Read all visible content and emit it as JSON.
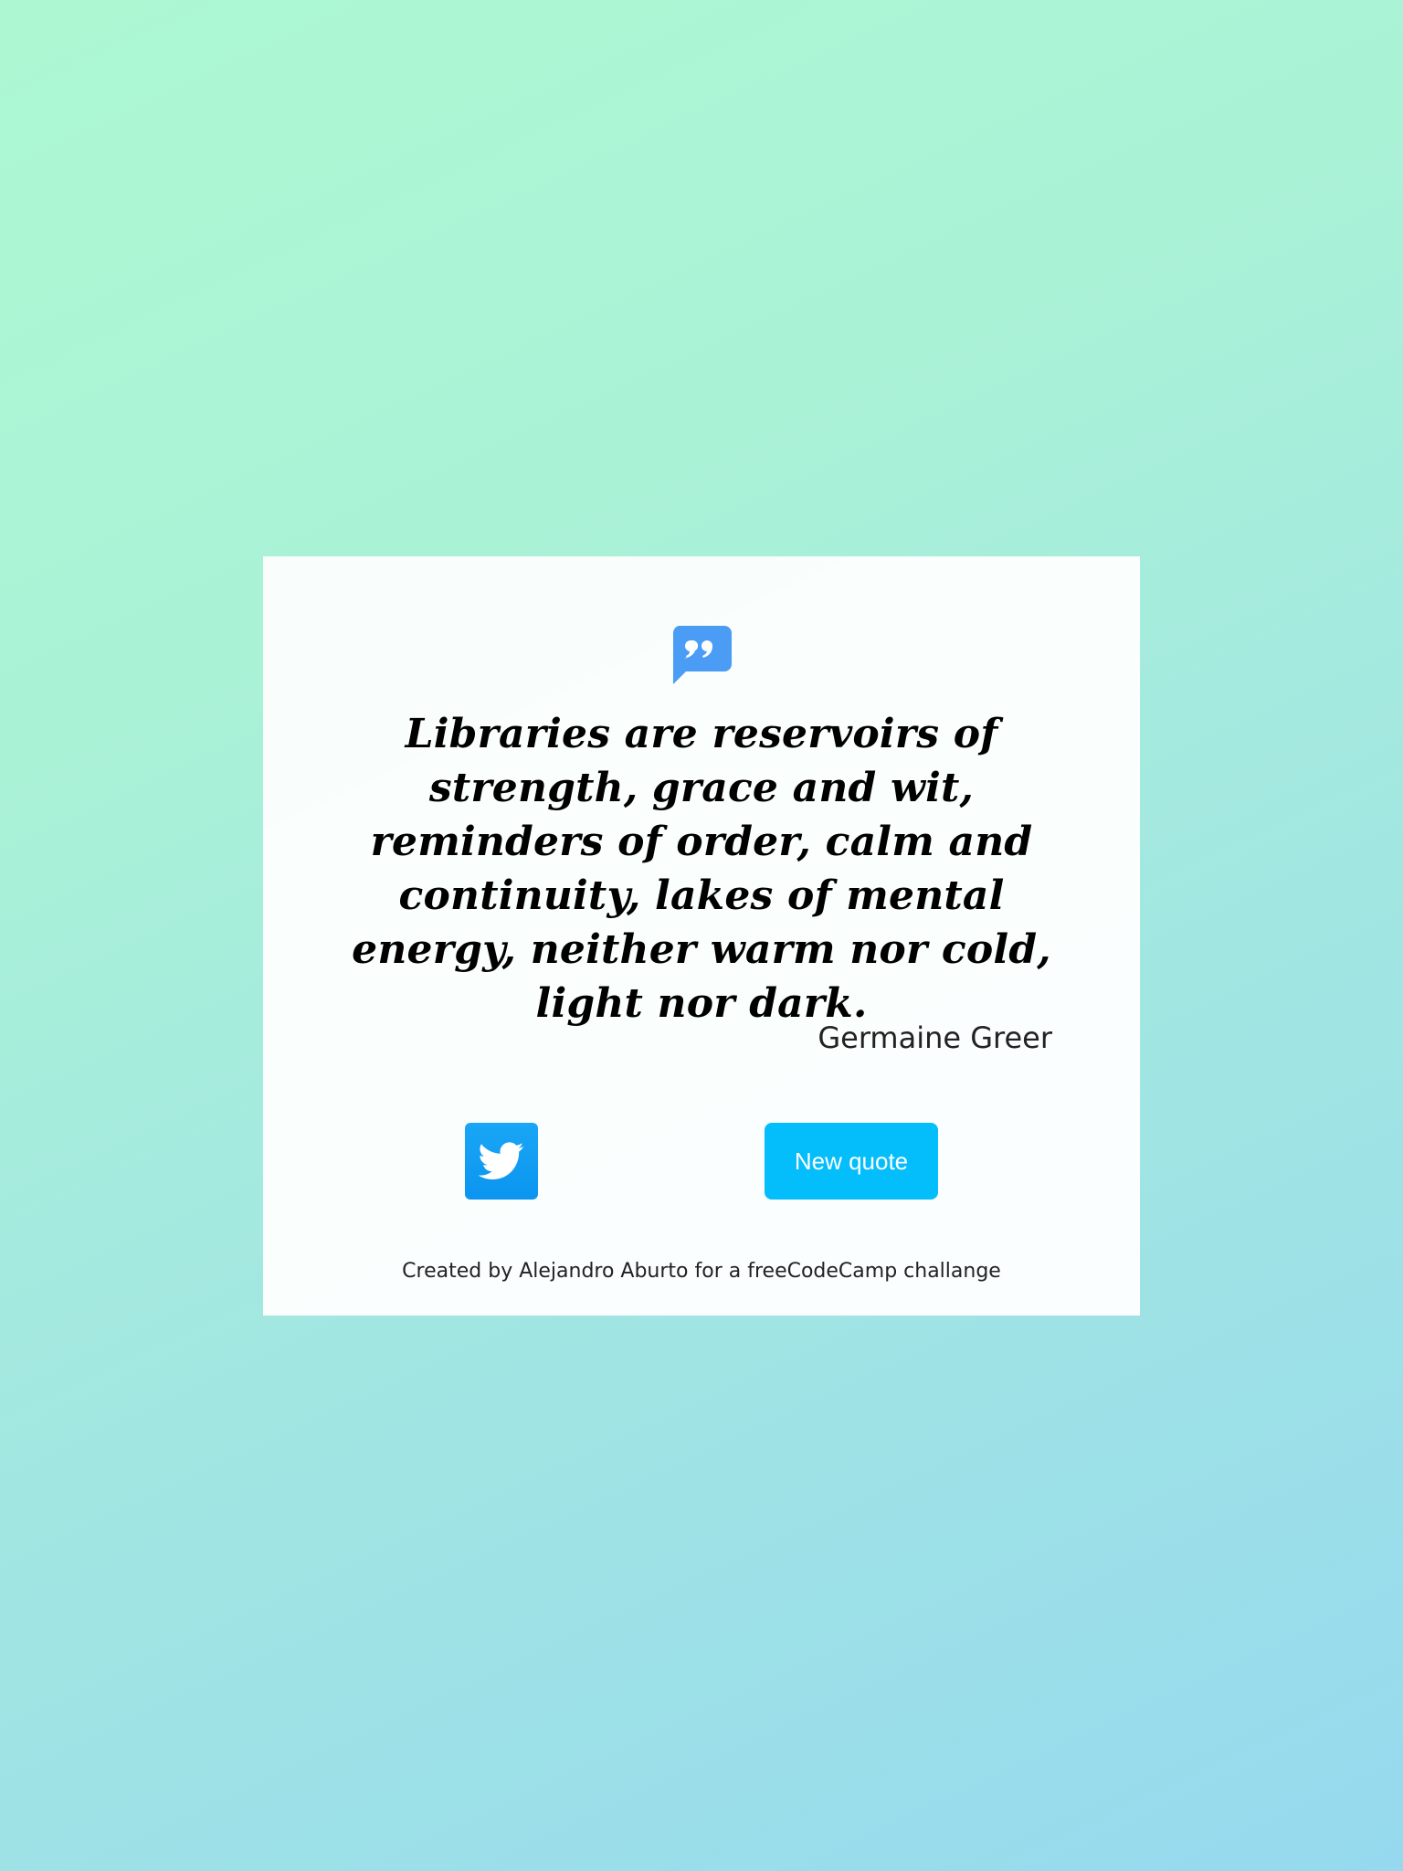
{
  "quote": {
    "icon": "quote-bubble-icon",
    "text": "Libraries are reservoirs of strength, grace and wit, reminders of order, calm and continuity, lakes of mental energy, neither warm nor cold, light nor dark.",
    "author": "Germaine Greer"
  },
  "actions": {
    "tweet_icon": "twitter-icon",
    "new_quote_label": "New quote"
  },
  "footer": {
    "text": "Created by Alejandro Aburto for a freeCodeCamp challange"
  },
  "colors": {
    "accent_icon": "#4a9cf4",
    "twitter_blue": "#1da1f2",
    "button_blue": "#04bdfb",
    "background_start": "#adf8d3",
    "background_end": "#96d9ef"
  }
}
